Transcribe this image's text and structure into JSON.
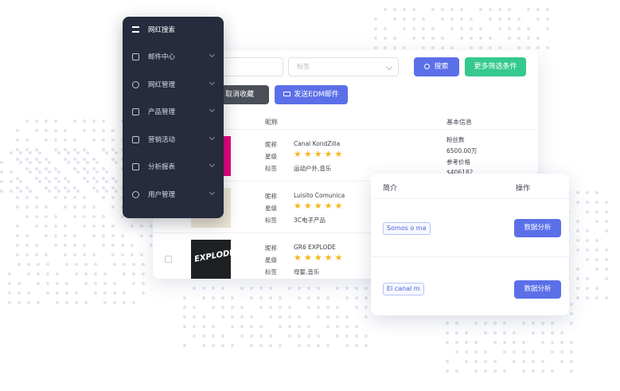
{
  "search": {
    "placeholder_2": "标签",
    "search_button": "搜索",
    "filter_button": "更多筛选条件"
  },
  "actions": {
    "cancel_favorite": "取消收藏",
    "send_edm": "发送EDM邮件"
  },
  "table": {
    "col_nickname": "昵称",
    "col_basic_info": "基本信息",
    "label_nickname": "昵称",
    "label_rating": "星级",
    "label_tags": "标签",
    "rows": [
      {
        "nickname": "Canal KondZilla",
        "rating": 5,
        "tags": "运动户外,音乐",
        "fans_label": "粉丝数",
        "fans_value": "6500.00万",
        "price_label": "参考价格",
        "price_value": "$406182"
      },
      {
        "nickname": "Luisito Comunica",
        "rating": 5,
        "tags": "3C电子产品"
      },
      {
        "nickname": "GR6 EXPLODE",
        "rating": 5,
        "tags": "母婴,音乐",
        "thumb_text": "EXPLODE"
      }
    ],
    "star_glyphs": "★★★★★"
  },
  "menu": {
    "items": [
      {
        "label": "网红搜索",
        "active": true,
        "icon": "bars-icon"
      },
      {
        "label": "邮件中心",
        "icon": "mail-icon"
      },
      {
        "label": "网红管理",
        "icon": "users-icon"
      },
      {
        "label": "产品管理",
        "icon": "product-icon"
      },
      {
        "label": "营销活动",
        "icon": "campaign-icon"
      },
      {
        "label": "分析报表",
        "icon": "report-icon"
      },
      {
        "label": "用户管理",
        "icon": "user-admin-icon"
      }
    ]
  },
  "popup": {
    "col_intro": "简介",
    "col_action": "操作",
    "rows": [
      {
        "intro": "Somos o ma",
        "action": "数据分析"
      },
      {
        "intro": "El canal m",
        "action": "数据分析"
      }
    ]
  },
  "colors": {
    "primary": "#5b6fe8",
    "success": "#35c98e",
    "menu_bg": "#262b3d",
    "star": "#f5b51c"
  }
}
